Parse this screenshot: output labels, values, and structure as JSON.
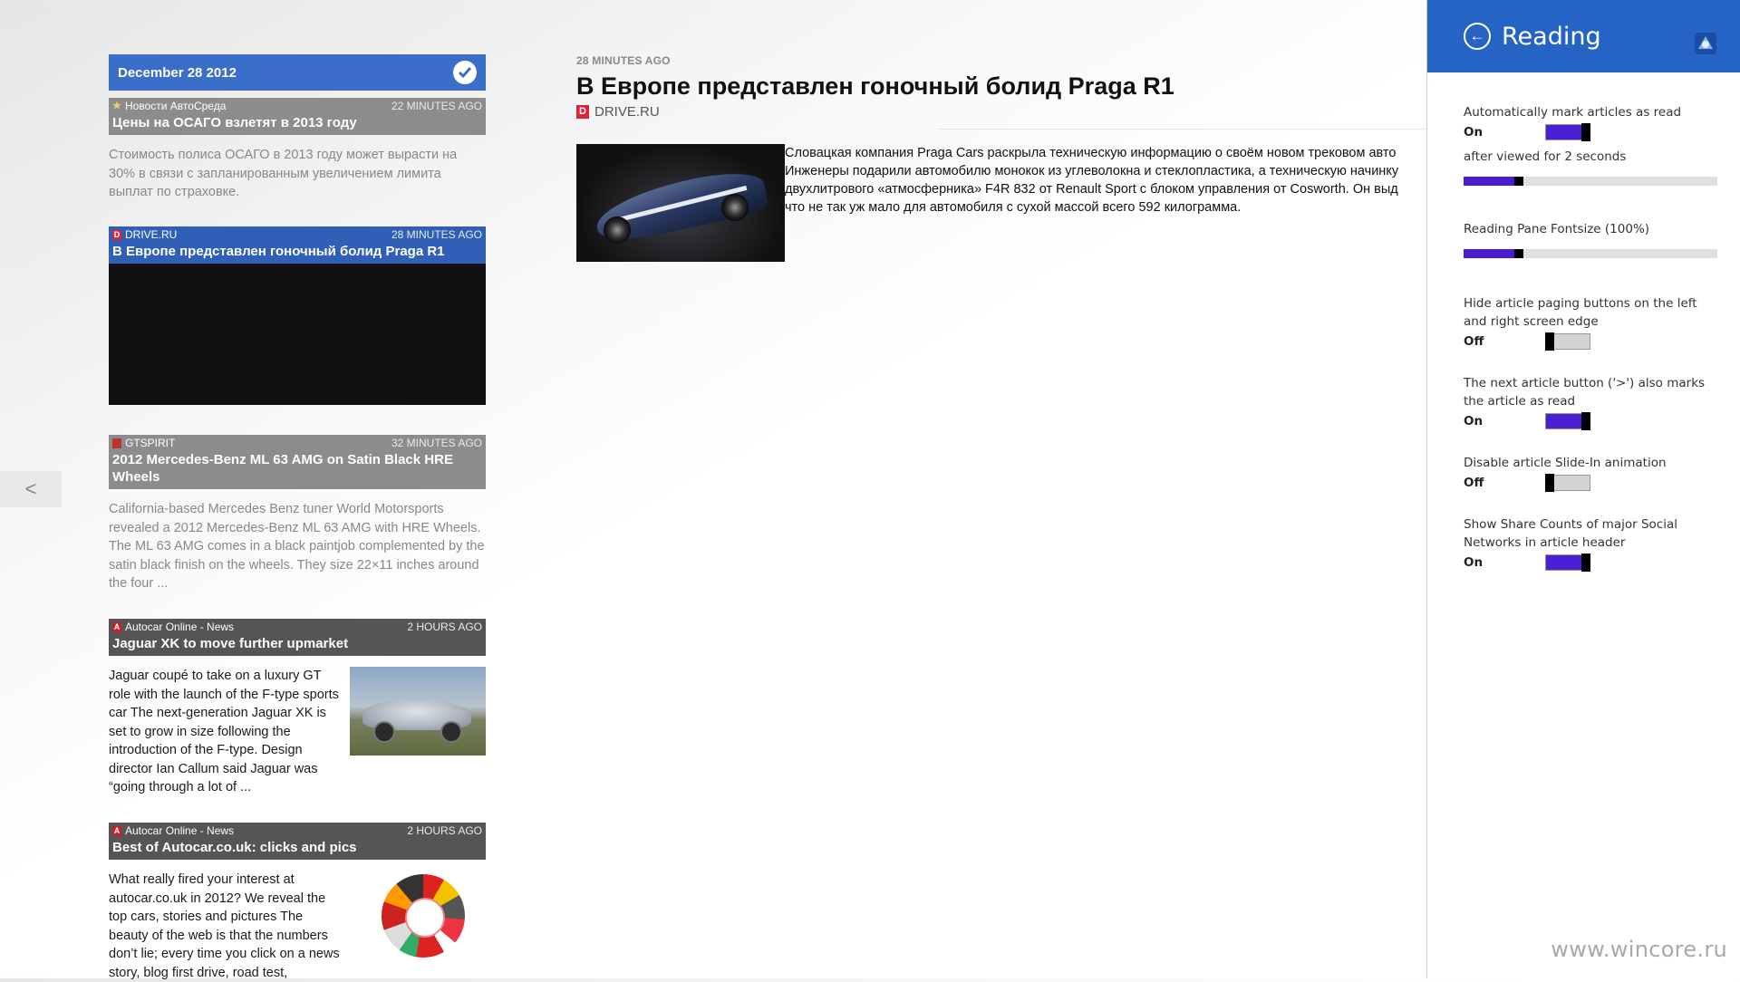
{
  "nav": {
    "back_glyph": "<"
  },
  "list": {
    "date": "December 28 2012",
    "items": [
      {
        "source": "Новости АвтоСреда",
        "time": "22 MINUTES AGO",
        "title": "Цены на ОСАГО взлетят в 2013 году",
        "excerpt": "Стоимость полиса ОСАГО в 2013 году может вырасти на 30% в связи с запланированным увеличением лимита выплат по страховке."
      },
      {
        "source": "DRIVE.RU",
        "badge": "D",
        "time": "28 MINUTES AGO",
        "title": "В Европе представлен гоночный болид Praga R1"
      },
      {
        "source": "GTSPIRIT",
        "time": "32 MINUTES AGO",
        "title": "2012 Mercedes-Benz ML 63 AMG on Satin Black HRE Wheels",
        "excerpt": "California-based Mercedes Benz tuner World Motorsports revealed a 2012 Mercedes-Benz ML 63 AMG with HRE Wheels. The ML 63 AMG comes in a black paintjob complemented by the satin black finish on the wheels. They size 22×11 inches around the four ..."
      },
      {
        "source": "Autocar Online - News",
        "badge": "A",
        "time": "2 HOURS AGO",
        "title": "Jaguar XK to move further upmarket",
        "excerpt": "Jaguar coupé to take on a luxury GT role with the launch of the F-type sports car The next-generation Jaguar XK is set to grow in size following the introduction of the F-type. Design director Ian Callum said Jaguar was “going through a lot of ..."
      },
      {
        "source": "Autocar Online - News",
        "badge": "A",
        "time": "2 HOURS AGO",
        "title": "Best of Autocar.co.uk: clicks and pics",
        "excerpt": "What really fired your interest at autocar.co.uk in 2012? We reveal the top cars, stories and pictures The beauty of the web is that the numbers don’t lie; every time you click on a news story, blog first drive, road test,"
      }
    ]
  },
  "reader": {
    "time": "28 MINUTES AGO",
    "title": "В Европе представлен гоночный болид Praga R1",
    "source": "DRIVE.RU",
    "source_badge": "D",
    "body_lines": [
      "Словацкая компания Praga Cars раскрыла техническую информацию о своём новом трековом авто",
      "Инженеры подарили автомобилю монокок из углеволокна и стеклопластика, а техническую начинку",
      "двухлитрового «атмосферника» F4R 832 от Renault Sport с блоком управления от Cosworth. Он выд",
      "что не так уж мало для автомобиля с сухой массой всего 592 килограмма."
    ]
  },
  "settings": {
    "title": "Reading",
    "auto_mark": {
      "label": "Automatically mark articles as read",
      "state": "On",
      "on": true
    },
    "after_viewed": {
      "label": "after viewed for 2 seconds",
      "value": 0.2
    },
    "fontsize": {
      "label": "Reading Pane Fontsize (100%)",
      "value": 0.2
    },
    "hide_paging": {
      "label": "Hide article paging buttons on the left and right screen edge",
      "state": "Off",
      "on": false
    },
    "next_marks": {
      "label": "The next article button ('>') also marks the article as read",
      "state": "On",
      "on": true
    },
    "disable_slide": {
      "label": "Disable article Slide-In animation",
      "state": "Off",
      "on": false
    },
    "share_counts": {
      "label": "Show Share Counts of major Social Networks in article header",
      "state": "On",
      "on": true
    }
  },
  "watermark": "www.wincore.ru",
  "colors": {
    "accent": "#2563c4",
    "toggle_on": "#4a1fd1",
    "tile_blue": "#2f5fb7",
    "tile_grey": "#8c8c8c",
    "tile_dark": "#555555"
  },
  "icons": [
    "chevron-left-icon",
    "check-icon",
    "back-arrow-icon",
    "app-logo-icon",
    "source-badge-icon"
  ]
}
